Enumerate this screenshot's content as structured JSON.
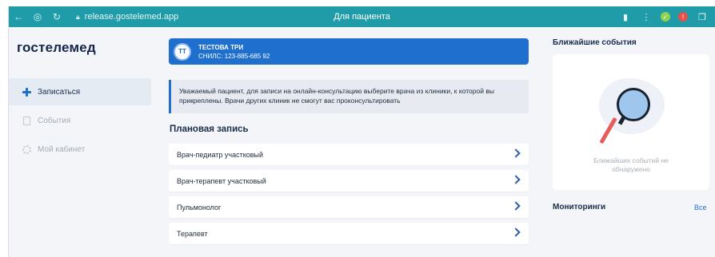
{
  "browser": {
    "url": "release.gostelemed.app",
    "page_title": "Для пациента",
    "colors": {
      "bar": "#1f9ca8"
    },
    "nav_icons": [
      "back-arrow-icon",
      "home-icon",
      "reload-icon"
    ],
    "right_icons": [
      "bookmark-icon",
      "menu-dots-icon",
      "extension-check-icon",
      "extension-alert-icon",
      "extension-puzzle-icon"
    ]
  },
  "sidebar": {
    "logo": "гостелемед",
    "items": [
      {
        "label": "Записаться",
        "icon": "plus-icon",
        "active": true
      },
      {
        "label": "События",
        "icon": "document-icon",
        "active": false
      },
      {
        "label": "Мой кабинет",
        "icon": "gear-icon",
        "active": false
      }
    ]
  },
  "patient": {
    "initials": "ТТ",
    "name": "ТЕСТОВА ТРИ",
    "snils": "СНИЛС: 123-885-685 92"
  },
  "notice": {
    "text": "Уважаемый пациент, для записи на онлайн-консультацию выберите врача из клиники, к которой вы прикреплены. Врачи других клиник не смогут вас проконсультировать"
  },
  "planned": {
    "title": "Плановая запись",
    "items": [
      {
        "label": "Врач-педиатр участковый"
      },
      {
        "label": "Врач-терапевт участковый"
      },
      {
        "label": "Пульмонолог"
      },
      {
        "label": "Терапевт"
      }
    ]
  },
  "events": {
    "title": "Ближайшие события",
    "empty_text": "Ближайших событий не обнаружено"
  },
  "monitoring": {
    "title": "Мониторинги",
    "all_link": "Все"
  },
  "colors": {
    "accent": "#1f6fcf",
    "background": "#f3f5f8"
  }
}
